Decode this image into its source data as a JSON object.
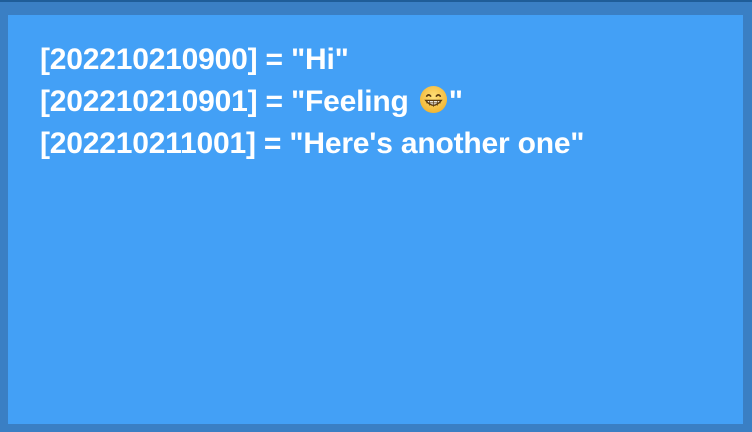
{
  "lines": [
    {
      "key": "[202210210900]",
      "op": " = ",
      "value_open": "\"Hi\"",
      "value_close": ""
    },
    {
      "key": "[202210210901]",
      "op": " = ",
      "value_open": "\"Feeling ",
      "value_close": "\""
    },
    {
      "key": "[202210211001]",
      "op": " = ",
      "value_open": "\"Here's another one\"",
      "value_close": ""
    }
  ],
  "emoji": {
    "icon": "grinning-face-icon",
    "color": "#f6c443"
  },
  "colors": {
    "panel": "#43a0f6",
    "frame": "#3a7fc4",
    "text": "#ffffff"
  }
}
